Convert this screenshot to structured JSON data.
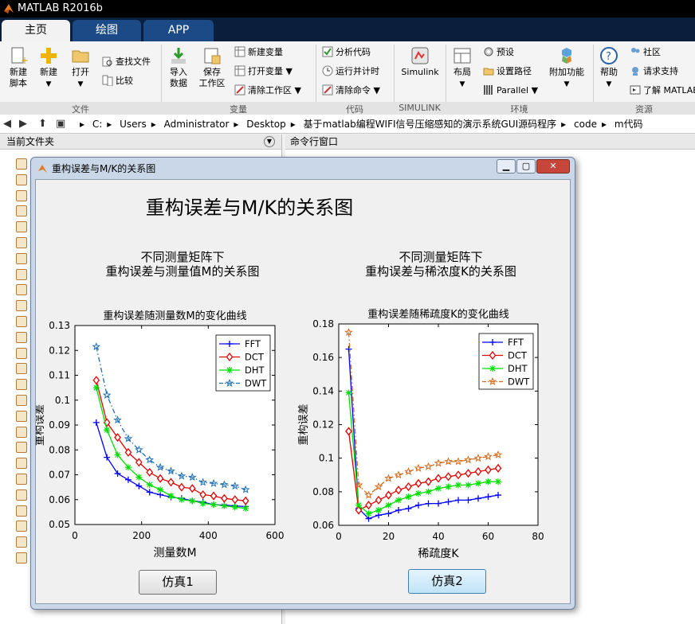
{
  "app": {
    "title": "MATLAB R2016b"
  },
  "tabs": [
    {
      "label": "主页"
    },
    {
      "label": "绘图"
    },
    {
      "label": "APP"
    }
  ],
  "ribbon": {
    "file": {
      "new_script": "新建\n脚本",
      "new": "新建",
      "open": "打开",
      "find_files": "查找文件",
      "compare": "比较",
      "group": "文件"
    },
    "variable": {
      "import": "导入\n数据",
      "save_ws": "保存\n工作区",
      "new_var": "新建变量",
      "open_var": "打开变量",
      "clear_ws": "清除工作区",
      "group": "变量"
    },
    "code": {
      "analyze": "分析代码",
      "run_time": "运行并计时",
      "clear_cmd": "清除命令",
      "group": "代码"
    },
    "simulink": {
      "label": "Simulink",
      "group": "SIMULINK"
    },
    "env": {
      "layout": "布局",
      "prefs": "预设",
      "set_path": "设置路径",
      "parallel": "Parallel",
      "addons": "附加功能",
      "group": "环境"
    },
    "resources": {
      "help": "帮助",
      "community": "社区",
      "support": "请求支持",
      "learn": "了解 MATLAB",
      "group": "资源"
    }
  },
  "address": {
    "path": [
      "C:",
      "Users",
      "Administrator",
      "Desktop",
      "基于matlab编程WIFI信号压缩感知的演示系统GUI源码程序",
      "code",
      "m代码"
    ]
  },
  "panels": {
    "current_folder": "当前文件夹",
    "command_window": "命令行窗口"
  },
  "figure": {
    "window_title": "重构误差与M/K的关系图",
    "main_title": "重构误差与M/K的关系图",
    "left_caption_1": "不同测量矩阵下",
    "left_caption_2": "重构误差与测量值M的关系图",
    "right_caption_1": "不同测量矩阵下",
    "right_caption_2": "重构误差与稀浓度K的关系图",
    "btn1": "仿真1",
    "btn2": "仿真2"
  },
  "colors": {
    "FFT": "#0000ff",
    "DCT": "#e00000",
    "DHT": "#00e000",
    "DWT": "#1f6fb5",
    "DWT_right": "#d56a1c"
  },
  "chart_data": [
    {
      "type": "line",
      "title": "重构误差随测量数M的变化曲线",
      "xlabel": "测量数M",
      "ylabel": "重构误差",
      "xlim": [
        0,
        600
      ],
      "ylim": [
        0.05,
        0.13
      ],
      "xticks": [
        0,
        200,
        400,
        600
      ],
      "yticks": [
        0.05,
        0.06,
        0.07,
        0.08,
        0.09,
        0.1,
        0.11,
        0.12,
        0.13
      ],
      "legend_position": "top-right",
      "x": [
        64,
        96,
        128,
        160,
        192,
        224,
        256,
        288,
        320,
        352,
        384,
        416,
        448,
        480,
        512
      ],
      "series": [
        {
          "name": "FFT",
          "marker": "+",
          "values": [
            0.091,
            0.077,
            0.0705,
            0.068,
            0.0655,
            0.063,
            0.062,
            0.061,
            0.0605,
            0.0595,
            0.059,
            0.058,
            0.0578,
            0.0575,
            0.0572
          ]
        },
        {
          "name": "DCT",
          "marker": "diamond",
          "values": [
            0.108,
            0.091,
            0.085,
            0.079,
            0.075,
            0.071,
            0.0685,
            0.067,
            0.065,
            0.0645,
            0.062,
            0.0615,
            0.0605,
            0.06,
            0.0595
          ]
        },
        {
          "name": "DHT",
          "marker": "asterisk",
          "values": [
            0.105,
            0.088,
            0.078,
            0.073,
            0.069,
            0.066,
            0.064,
            0.0615,
            0.06,
            0.0595,
            0.0585,
            0.058,
            0.0575,
            0.057,
            0.0565
          ]
        },
        {
          "name": "DWT",
          "marker": "pentagram",
          "dashed": true,
          "values": [
            0.1215,
            0.102,
            0.092,
            0.0845,
            0.08,
            0.076,
            0.073,
            0.0715,
            0.0695,
            0.069,
            0.067,
            0.0665,
            0.066,
            0.0655,
            0.064
          ]
        }
      ]
    },
    {
      "type": "line",
      "title": "重构误差随稀疏度K的变化曲线",
      "xlabel": "稀疏度K",
      "ylabel": "重构误差",
      "xlim": [
        0,
        80
      ],
      "ylim": [
        0.06,
        0.18
      ],
      "xticks": [
        0,
        20,
        40,
        60,
        80
      ],
      "yticks": [
        0.06,
        0.08,
        0.1,
        0.12,
        0.14,
        0.16,
        0.18
      ],
      "legend_position": "top-right",
      "x": [
        4,
        8,
        12,
        16,
        20,
        24,
        28,
        32,
        36,
        40,
        44,
        48,
        52,
        56,
        60,
        64
      ],
      "series": [
        {
          "name": "FFT",
          "marker": "+",
          "values": [
            0.165,
            0.07,
            0.064,
            0.066,
            0.067,
            0.069,
            0.07,
            0.072,
            0.073,
            0.073,
            0.074,
            0.075,
            0.075,
            0.076,
            0.077,
            0.078
          ]
        },
        {
          "name": "DCT",
          "marker": "diamond",
          "values": [
            0.116,
            0.069,
            0.072,
            0.075,
            0.078,
            0.081,
            0.083,
            0.085,
            0.086,
            0.088,
            0.089,
            0.09,
            0.091,
            0.092,
            0.093,
            0.094
          ]
        },
        {
          "name": "DHT",
          "marker": "asterisk",
          "values": [
            0.139,
            0.072,
            0.067,
            0.069,
            0.072,
            0.075,
            0.077,
            0.079,
            0.08,
            0.082,
            0.083,
            0.084,
            0.084,
            0.085,
            0.086,
            0.086
          ]
        },
        {
          "name": "DWT",
          "marker": "pentagram",
          "dashed": true,
          "values": [
            0.175,
            0.084,
            0.078,
            0.083,
            0.088,
            0.09,
            0.092,
            0.094,
            0.095,
            0.097,
            0.098,
            0.098,
            0.099,
            0.1,
            0.101,
            0.102
          ]
        }
      ]
    }
  ]
}
